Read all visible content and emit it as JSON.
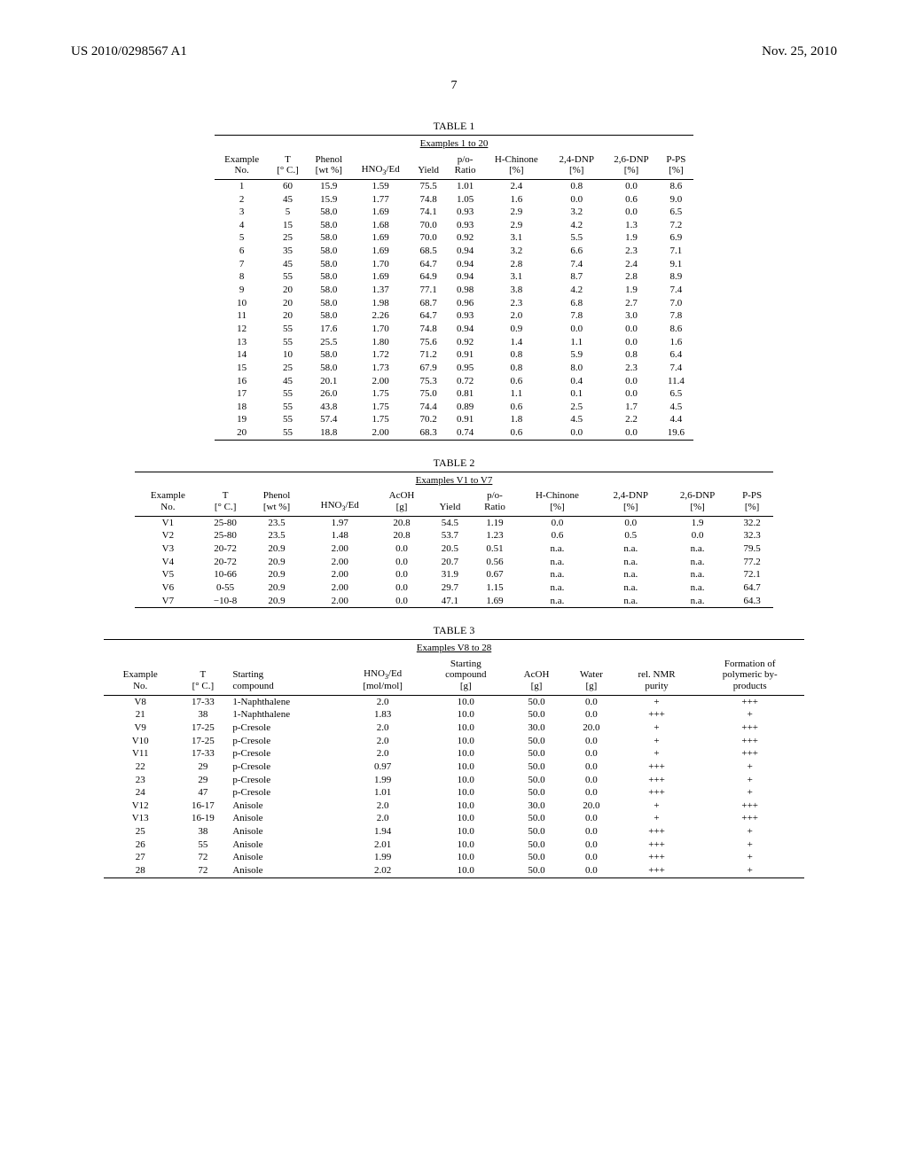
{
  "header": {
    "pub_number": "US 2010/0298567 A1",
    "date": "Nov. 25, 2010",
    "page": "7"
  },
  "table1": {
    "title": "TABLE 1",
    "subtitle": "Examples 1 to 20",
    "headers": {
      "example_no": "Example\nNo.",
      "t_c": "T\n[° C.]",
      "phenol": "Phenol\n[wt %]",
      "hno3_ed": "HNO₃/Ed",
      "yield": "Yield",
      "po_ratio": "p/o-\nRatio",
      "h_chinone": "H-Chinone\n[%]",
      "dnp24": "2,4-DNP\n[%]",
      "dnp26": "2,6-DNP\n[%]",
      "pps": "P-PS\n[%]"
    },
    "rows": [
      {
        "no": "1",
        "t": "60",
        "phenol": "15.9",
        "hno3": "1.59",
        "yield": "75.5",
        "po": "1.01",
        "hc": "2.4",
        "d24": "0.8",
        "d26": "0.0",
        "pps": "8.6"
      },
      {
        "no": "2",
        "t": "45",
        "phenol": "15.9",
        "hno3": "1.77",
        "yield": "74.8",
        "po": "1.05",
        "hc": "1.6",
        "d24": "0.0",
        "d26": "0.6",
        "pps": "9.0"
      },
      {
        "no": "3",
        "t": "5",
        "phenol": "58.0",
        "hno3": "1.69",
        "yield": "74.1",
        "po": "0.93",
        "hc": "2.9",
        "d24": "3.2",
        "d26": "0.0",
        "pps": "6.5"
      },
      {
        "no": "4",
        "t": "15",
        "phenol": "58.0",
        "hno3": "1.68",
        "yield": "70.0",
        "po": "0.93",
        "hc": "2.9",
        "d24": "4.2",
        "d26": "1.3",
        "pps": "7.2"
      },
      {
        "no": "5",
        "t": "25",
        "phenol": "58.0",
        "hno3": "1.69",
        "yield": "70.0",
        "po": "0.92",
        "hc": "3.1",
        "d24": "5.5",
        "d26": "1.9",
        "pps": "6.9"
      },
      {
        "no": "6",
        "t": "35",
        "phenol": "58.0",
        "hno3": "1.69",
        "yield": "68.5",
        "po": "0.94",
        "hc": "3.2",
        "d24": "6.6",
        "d26": "2.3",
        "pps": "7.1"
      },
      {
        "no": "7",
        "t": "45",
        "phenol": "58.0",
        "hno3": "1.70",
        "yield": "64.7",
        "po": "0.94",
        "hc": "2.8",
        "d24": "7.4",
        "d26": "2.4",
        "pps": "9.1"
      },
      {
        "no": "8",
        "t": "55",
        "phenol": "58.0",
        "hno3": "1.69",
        "yield": "64.9",
        "po": "0.94",
        "hc": "3.1",
        "d24": "8.7",
        "d26": "2.8",
        "pps": "8.9"
      },
      {
        "no": "9",
        "t": "20",
        "phenol": "58.0",
        "hno3": "1.37",
        "yield": "77.1",
        "po": "0.98",
        "hc": "3.8",
        "d24": "4.2",
        "d26": "1.9",
        "pps": "7.4"
      },
      {
        "no": "10",
        "t": "20",
        "phenol": "58.0",
        "hno3": "1.98",
        "yield": "68.7",
        "po": "0.96",
        "hc": "2.3",
        "d24": "6.8",
        "d26": "2.7",
        "pps": "7.0"
      },
      {
        "no": "11",
        "t": "20",
        "phenol": "58.0",
        "hno3": "2.26",
        "yield": "64.7",
        "po": "0.93",
        "hc": "2.0",
        "d24": "7.8",
        "d26": "3.0",
        "pps": "7.8"
      },
      {
        "no": "12",
        "t": "55",
        "phenol": "17.6",
        "hno3": "1.70",
        "yield": "74.8",
        "po": "0.94",
        "hc": "0.9",
        "d24": "0.0",
        "d26": "0.0",
        "pps": "8.6"
      },
      {
        "no": "13",
        "t": "55",
        "phenol": "25.5",
        "hno3": "1.80",
        "yield": "75.6",
        "po": "0.92",
        "hc": "1.4",
        "d24": "1.1",
        "d26": "0.0",
        "pps": "1.6"
      },
      {
        "no": "14",
        "t": "10",
        "phenol": "58.0",
        "hno3": "1.72",
        "yield": "71.2",
        "po": "0.91",
        "hc": "0.8",
        "d24": "5.9",
        "d26": "0.8",
        "pps": "6.4"
      },
      {
        "no": "15",
        "t": "25",
        "phenol": "58.0",
        "hno3": "1.73",
        "yield": "67.9",
        "po": "0.95",
        "hc": "0.8",
        "d24": "8.0",
        "d26": "2.3",
        "pps": "7.4"
      },
      {
        "no": "16",
        "t": "45",
        "phenol": "20.1",
        "hno3": "2.00",
        "yield": "75.3",
        "po": "0.72",
        "hc": "0.6",
        "d24": "0.4",
        "d26": "0.0",
        "pps": "11.4"
      },
      {
        "no": "17",
        "t": "55",
        "phenol": "26.0",
        "hno3": "1.75",
        "yield": "75.0",
        "po": "0.81",
        "hc": "1.1",
        "d24": "0.1",
        "d26": "0.0",
        "pps": "6.5"
      },
      {
        "no": "18",
        "t": "55",
        "phenol": "43.8",
        "hno3": "1.75",
        "yield": "74.4",
        "po": "0.89",
        "hc": "0.6",
        "d24": "2.5",
        "d26": "1.7",
        "pps": "4.5"
      },
      {
        "no": "19",
        "t": "55",
        "phenol": "57.4",
        "hno3": "1.75",
        "yield": "70.2",
        "po": "0.91",
        "hc": "1.8",
        "d24": "4.5",
        "d26": "2.2",
        "pps": "4.4"
      },
      {
        "no": "20",
        "t": "55",
        "phenol": "18.8",
        "hno3": "2.00",
        "yield": "68.3",
        "po": "0.74",
        "hc": "0.6",
        "d24": "0.0",
        "d26": "0.0",
        "pps": "19.6"
      }
    ]
  },
  "table2": {
    "title": "TABLE 2",
    "subtitle": "Examples V1 to V7",
    "headers": {
      "example_no": "Example\nNo.",
      "t_c": "T\n[° C.]",
      "phenol": "Phenol\n[wt %]",
      "hno3_ed": "HNO₃/Ed",
      "acoh": "AcOH\n[g]",
      "yield": "Yield",
      "po_ratio": "p/o-\nRatio",
      "h_chinone": "H-Chinone\n[%]",
      "dnp24": "2,4-DNP\n[%]",
      "dnp26": "2,6-DNP\n[%]",
      "pps": "P-PS\n[%]"
    },
    "rows": [
      {
        "no": "V1",
        "t": "25-80",
        "phenol": "23.5",
        "hno3": "1.97",
        "acoh": "20.8",
        "yield": "54.5",
        "po": "1.19",
        "hc": "0.0",
        "d24": "0.0",
        "d26": "1.9",
        "pps": "32.2"
      },
      {
        "no": "V2",
        "t": "25-80",
        "phenol": "23.5",
        "hno3": "1.48",
        "acoh": "20.8",
        "yield": "53.7",
        "po": "1.23",
        "hc": "0.6",
        "d24": "0.5",
        "d26": "0.0",
        "pps": "32.3"
      },
      {
        "no": "V3",
        "t": "20-72",
        "phenol": "20.9",
        "hno3": "2.00",
        "acoh": "0.0",
        "yield": "20.5",
        "po": "0.51",
        "hc": "n.a.",
        "d24": "n.a.",
        "d26": "n.a.",
        "pps": "79.5"
      },
      {
        "no": "V4",
        "t": "20-72",
        "phenol": "20.9",
        "hno3": "2.00",
        "acoh": "0.0",
        "yield": "20.7",
        "po": "0.56",
        "hc": "n.a.",
        "d24": "n.a.",
        "d26": "n.a.",
        "pps": "77.2"
      },
      {
        "no": "V5",
        "t": "10-66",
        "phenol": "20.9",
        "hno3": "2.00",
        "acoh": "0.0",
        "yield": "31.9",
        "po": "0.67",
        "hc": "n.a.",
        "d24": "n.a.",
        "d26": "n.a.",
        "pps": "72.1"
      },
      {
        "no": "V6",
        "t": "0-55",
        "phenol": "20.9",
        "hno3": "2.00",
        "acoh": "0.0",
        "yield": "29.7",
        "po": "1.15",
        "hc": "n.a.",
        "d24": "n.a.",
        "d26": "n.a.",
        "pps": "64.7"
      },
      {
        "no": "V7",
        "t": "−10-8",
        "phenol": "20.9",
        "hno3": "2.00",
        "acoh": "0.0",
        "yield": "47.1",
        "po": "1.69",
        "hc": "n.a.",
        "d24": "n.a.",
        "d26": "n.a.",
        "pps": "64.3"
      }
    ]
  },
  "table3": {
    "title": "TABLE 3",
    "subtitle": "Examples V8 to 28",
    "headers": {
      "example_no": "Example\nNo.",
      "t_c": "T\n[° C.]",
      "starting": "Starting\ncompound",
      "hno3_ed": "HNO₃/Ed\n[mol/mol]",
      "starting_g": "Starting\ncompound\n[g]",
      "acoh": "AcOH\n[g]",
      "water": "Water\n[g]",
      "nmr": "rel. NMR\npurity",
      "poly": "Formation of\npolymeric by-\nproducts"
    },
    "rows": [
      {
        "no": "V8",
        "t": "17-33",
        "sc": "1-Naphthalene",
        "hno3": "2.0",
        "sg": "10.0",
        "acoh": "50.0",
        "water": "0.0",
        "nmr": "+",
        "poly": "+++"
      },
      {
        "no": "21",
        "t": "38",
        "sc": "1-Naphthalene",
        "hno3": "1.83",
        "sg": "10.0",
        "acoh": "50.0",
        "water": "0.0",
        "nmr": "+++",
        "poly": "+"
      },
      {
        "no": "V9",
        "t": "17-25",
        "sc": "p-Cresole",
        "hno3": "2.0",
        "sg": "10.0",
        "acoh": "30.0",
        "water": "20.0",
        "nmr": "+",
        "poly": "+++"
      },
      {
        "no": "V10",
        "t": "17-25",
        "sc": "p-Cresole",
        "hno3": "2.0",
        "sg": "10.0",
        "acoh": "50.0",
        "water": "0.0",
        "nmr": "+",
        "poly": "+++"
      },
      {
        "no": "V11",
        "t": "17-33",
        "sc": "p-Cresole",
        "hno3": "2.0",
        "sg": "10.0",
        "acoh": "50.0",
        "water": "0.0",
        "nmr": "+",
        "poly": "+++"
      },
      {
        "no": "22",
        "t": "29",
        "sc": "p-Cresole",
        "hno3": "0.97",
        "sg": "10.0",
        "acoh": "50.0",
        "water": "0.0",
        "nmr": "+++",
        "poly": "+"
      },
      {
        "no": "23",
        "t": "29",
        "sc": "p-Cresole",
        "hno3": "1.99",
        "sg": "10.0",
        "acoh": "50.0",
        "water": "0.0",
        "nmr": "+++",
        "poly": "+"
      },
      {
        "no": "24",
        "t": "47",
        "sc": "p-Cresole",
        "hno3": "1.01",
        "sg": "10.0",
        "acoh": "50.0",
        "water": "0.0",
        "nmr": "+++",
        "poly": "+"
      },
      {
        "no": "V12",
        "t": "16-17",
        "sc": "Anisole",
        "hno3": "2.0",
        "sg": "10.0",
        "acoh": "30.0",
        "water": "20.0",
        "nmr": "+",
        "poly": "+++"
      },
      {
        "no": "V13",
        "t": "16-19",
        "sc": "Anisole",
        "hno3": "2.0",
        "sg": "10.0",
        "acoh": "50.0",
        "water": "0.0",
        "nmr": "+",
        "poly": "+++"
      },
      {
        "no": "25",
        "t": "38",
        "sc": "Anisole",
        "hno3": "1.94",
        "sg": "10.0",
        "acoh": "50.0",
        "water": "0.0",
        "nmr": "+++",
        "poly": "+"
      },
      {
        "no": "26",
        "t": "55",
        "sc": "Anisole",
        "hno3": "2.01",
        "sg": "10.0",
        "acoh": "50.0",
        "water": "0.0",
        "nmr": "+++",
        "poly": "+"
      },
      {
        "no": "27",
        "t": "72",
        "sc": "Anisole",
        "hno3": "1.99",
        "sg": "10.0",
        "acoh": "50.0",
        "water": "0.0",
        "nmr": "+++",
        "poly": "+"
      },
      {
        "no": "28",
        "t": "72",
        "sc": "Anisole",
        "hno3": "2.02",
        "sg": "10.0",
        "acoh": "50.0",
        "water": "0.0",
        "nmr": "+++",
        "poly": "+"
      }
    ]
  }
}
